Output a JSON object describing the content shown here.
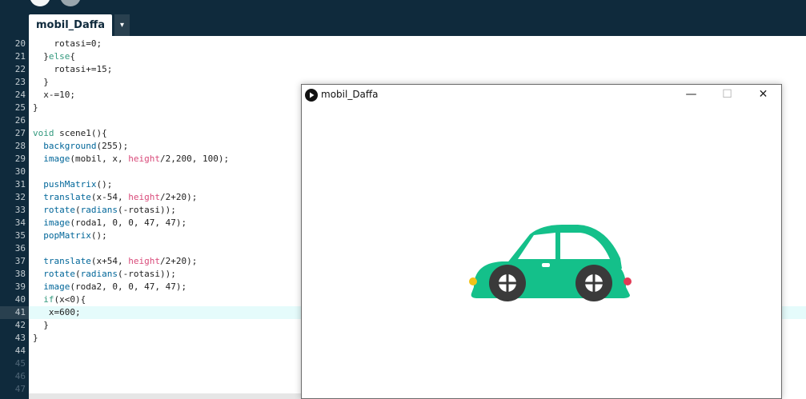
{
  "editor": {
    "tab_label": "mobil_Daffa",
    "tab_menu_icon": "▾",
    "current_line": 41,
    "lines": [
      {
        "n": "20",
        "code": "    rotasi=0;"
      },
      {
        "n": "21",
        "code": "  }else{"
      },
      {
        "n": "22",
        "code": "    rotasi+=15;"
      },
      {
        "n": "23",
        "code": "  }"
      },
      {
        "n": "24",
        "code": "  x-=10;"
      },
      {
        "n": "25",
        "code": "}"
      },
      {
        "n": "26",
        "code": ""
      },
      {
        "n": "27",
        "code": "void scene1(){"
      },
      {
        "n": "28",
        "code": "  background(255);"
      },
      {
        "n": "29",
        "code": "  image(mobil, x, height/2,200, 100);"
      },
      {
        "n": "30",
        "code": ""
      },
      {
        "n": "31",
        "code": "  pushMatrix();"
      },
      {
        "n": "32",
        "code": "  translate(x-54, height/2+20);"
      },
      {
        "n": "33",
        "code": "  rotate(radians(-rotasi));"
      },
      {
        "n": "34",
        "code": "  image(roda1, 0, 0, 47, 47);"
      },
      {
        "n": "35",
        "code": "  popMatrix();"
      },
      {
        "n": "36",
        "code": ""
      },
      {
        "n": "37",
        "code": "  translate(x+54, height/2+20);"
      },
      {
        "n": "38",
        "code": "  rotate(radians(-rotasi));"
      },
      {
        "n": "39",
        "code": "  image(roda2, 0, 0, 47, 47);"
      },
      {
        "n": "40",
        "code": "  if(x<0){"
      },
      {
        "n": "41",
        "code": "   x=600;"
      },
      {
        "n": "42",
        "code": "  }"
      },
      {
        "n": "43",
        "code": "}"
      },
      {
        "n": "44",
        "code": ""
      },
      {
        "n": "45",
        "code": ""
      },
      {
        "n": "46",
        "code": ""
      },
      {
        "n": "47",
        "code": ""
      }
    ]
  },
  "sketch_window": {
    "title": "mobil_Daffa",
    "minimize_icon": "—",
    "maximize_icon": "☐",
    "close_icon": "✕",
    "car_colors": {
      "body": "#14c08a",
      "window": "#ffffff",
      "wheel": "#3a3a3a",
      "headlight": "#f2c21a",
      "taillight": "#e23a55"
    }
  },
  "colors": {
    "ide_dark": "#0f2a3c",
    "keyword": "#33997e",
    "function": "#006699",
    "variable": "#d94a7a",
    "current_line": "#e5fbfb"
  }
}
